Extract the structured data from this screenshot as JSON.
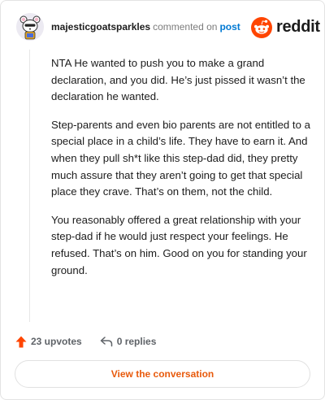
{
  "header": {
    "username": "majesticgoatsparkles",
    "action_text": "commented on",
    "post_link": "post",
    "brand": "reddit"
  },
  "comment": {
    "paragraphs": [
      "NTA He wanted to push you to make a grand declaration, and you did. He’s just pissed it wasn’t the declaration he wanted.",
      "Step-parents and even bio parents are not entitled to a special place in a child’s life. They have to earn it. And when they pull sh*t like this step-dad did, they pretty much assure that they aren’t going to get that special place they crave. That’s on them, not the child.",
      "You reasonably offered a great relationship with your step-dad if he would just respect your feelings. He refused. That’s on him. Good on you for standing your ground."
    ]
  },
  "footer": {
    "upvotes_label": "23 upvotes",
    "replies_label": "0 replies",
    "view_button": "View the conversation"
  },
  "icons": {
    "avatar": "snoo-avatar-icon",
    "logo": "reddit-snoo-icon",
    "upvote": "upvote-arrow-icon",
    "reply": "reply-arrow-icon"
  },
  "colors": {
    "brand_orange": "#ff4500",
    "upvote": "#ff4500",
    "link_blue": "#0079d3",
    "button_text": "#e85a0c"
  }
}
